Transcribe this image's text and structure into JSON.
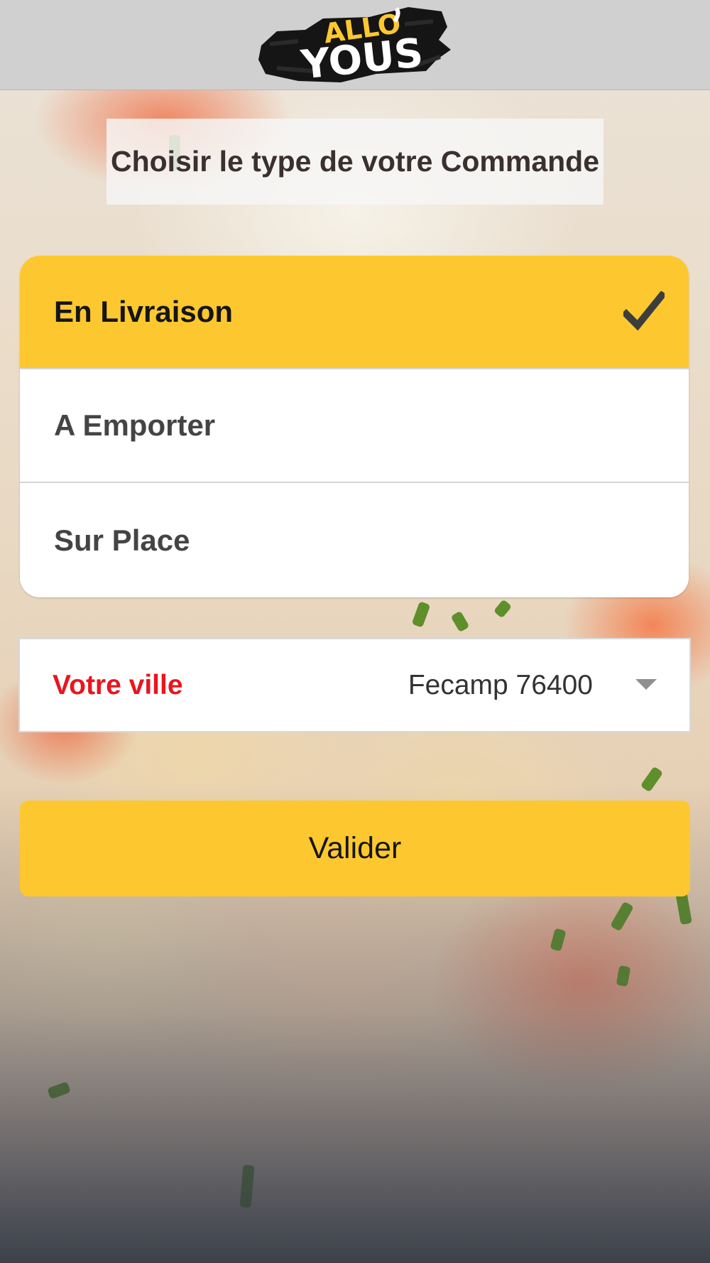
{
  "app": {
    "logo_text": "ALLO YOUS",
    "brand_color": "#fdc82f",
    "accent_color": "#e8161f"
  },
  "page": {
    "title": "Choisir le type de votre Commande"
  },
  "order_types": {
    "selected": "En Livraison",
    "options": [
      {
        "label": "En Livraison",
        "selected": true
      },
      {
        "label": "A Emporter",
        "selected": false
      },
      {
        "label": "Sur Place",
        "selected": false
      }
    ]
  },
  "city": {
    "label": "Votre ville",
    "value": "Fecamp 76400"
  },
  "actions": {
    "submit_label": "Valider"
  },
  "icons": {
    "check": "check-icon",
    "dropdown": "caret-down-icon"
  }
}
